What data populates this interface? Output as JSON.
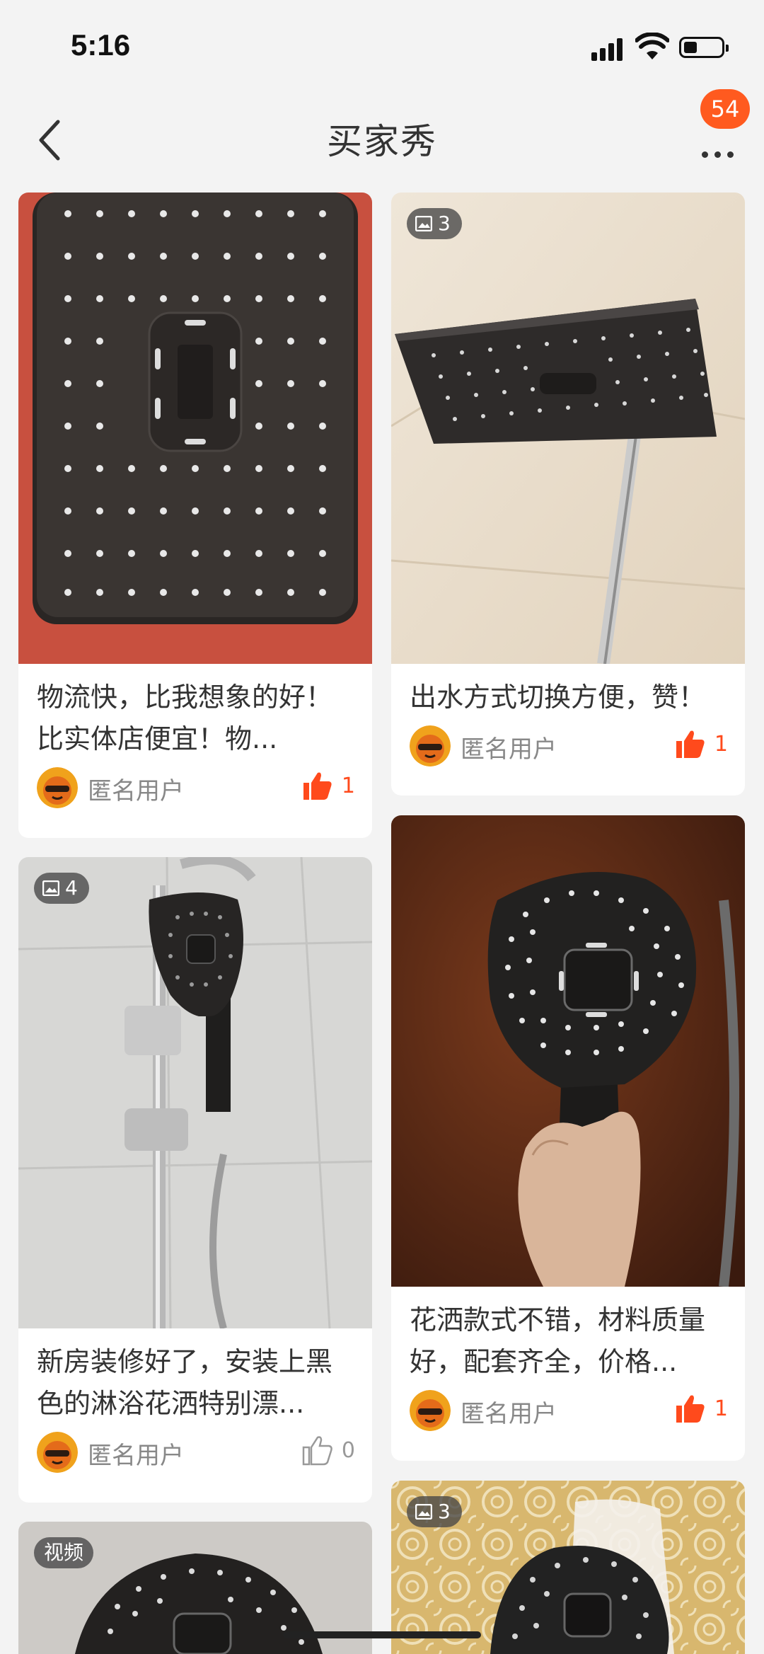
{
  "status_bar": {
    "time": "5:16"
  },
  "header": {
    "title": "买家秀",
    "more_badge": "54"
  },
  "colors": {
    "accent": "#ff5a1f",
    "like_active": "#ff4a1c",
    "like_inactive": "#999999"
  },
  "posts": [
    {
      "image_count": "",
      "text": "物流快，比我想象的好！比实体店便宜！物...",
      "user": "匿名用户",
      "likes": "1",
      "liked": true
    },
    {
      "image_count": "3",
      "text": "出水方式切换方便，赞！",
      "user": "匿名用户",
      "likes": "1",
      "liked": true
    },
    {
      "image_count": "4",
      "text": "新房装修好了，安装上黑色的淋浴花洒特别漂...",
      "user": "匿名用户",
      "likes": "0",
      "liked": false
    },
    {
      "image_count": "",
      "text": "花洒款式不错，材料质量好，配套齐全，价格...",
      "user": "匿名用户",
      "likes": "1",
      "liked": true
    },
    {
      "tag": "视频"
    },
    {
      "image_count": "3"
    }
  ]
}
